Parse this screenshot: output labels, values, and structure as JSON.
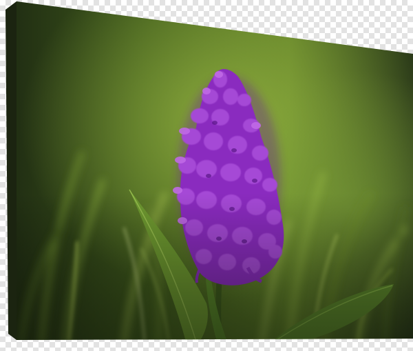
{
  "image": {
    "subject": "canvas-print-photo",
    "colors": {
      "checker_light": "#ffffff",
      "checker_dark": "#e2e2e2",
      "canvas_edge": "#1b2410",
      "background_green": "#3f5a1c",
      "highlight_green": "#9fbf45",
      "flower_purple": "#8a2bbf",
      "flower_highlight": "#c06ae6",
      "leaf_green": "#5e8a2c"
    }
  }
}
